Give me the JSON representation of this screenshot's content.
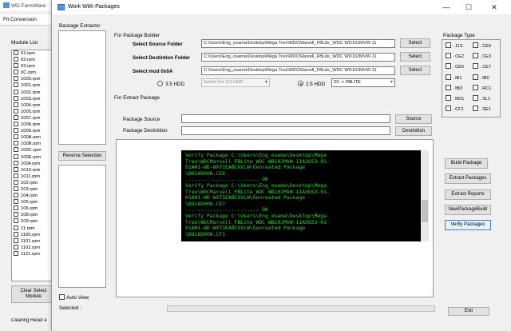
{
  "background_window": {
    "title": "WD FarmWare",
    "tab": "Fit Conversion",
    "module_list_label": "Module List",
    "modules": [
      "01.rpm",
      "02.rpm",
      "03.rpm",
      "0C.rpm",
      "1000.rpm",
      "1001.rpm",
      "1002.rpm",
      "1003.rpm",
      "1004.rpm",
      "1005.rpm",
      "1007.rpm",
      "1008.rpm",
      "1009.rpm",
      "100A.rpm",
      "100B.rpm",
      "100C.rpm",
      "100E.rpm",
      "100F.rpm",
      "1010.rpm",
      "1011.rpm",
      "102.rpm",
      "103.rpm",
      "104.rpm",
      "105.rpm",
      "106.rpm",
      "108.rpm",
      "109.rpm",
      "11.rpm",
      "1100.rpm",
      "1101.rpm",
      "1102.rpm",
      "1121.rpm"
    ],
    "clear_button": "Clear Select Module",
    "status": "Clearing Reset e"
  },
  "window": {
    "title": "Work With Packages",
    "controls": {
      "minimize": "—",
      "maximize": "☐",
      "close": "✕"
    }
  },
  "extractor": {
    "label": "Backage Extractor",
    "reverse_button": "Reverse Selection",
    "auto_view_label": "Auto View",
    "selected_label": "Selected :"
  },
  "builder": {
    "group_label": "For Package Builder",
    "source_label": "Select Source Folder",
    "source_path": "C:\\Users\\Eng_osama\\Desktop\\Mega Trex\\WDCMarvell_FBLite_WDC WD10JMVW-11",
    "dest_label": "Select Destintion Folder",
    "dest_path": "C:\\Users\\Eng_osama\\Desktop\\Mega Trex\\WDCMarvell_FBLite_WDC WD10JMVW-11",
    "mod_label": "Select mod 0x0A",
    "mod_path": "C:\\Users\\Eng_osama\\Desktop\\Mega Trex\\WDCMarvell_FBLite_WDC WD10JMVW-11",
    "select_button": "Select",
    "hdd35_label": "3.5 HDD",
    "hdd35_combo": "Select For 3.5 HDD",
    "hdd25_label": "2.5 HDD",
    "hdd25_combo": "23 -> FBLITE"
  },
  "extract": {
    "group_label": "For Extract Package",
    "source_label": "Package Source",
    "dest_label": "Package Destinition",
    "source_button": "Source",
    "dest_button": "Destinition"
  },
  "console": {
    "text": "Verify Package C:\\Users\\Eng_osama\\Desktop\\Mega\nTrex\\WDCMarvell_FBLite_WDC WD10JMVW-11A3GS3-01-\n01A01-WD-WXT1EA8CXVLW\\Genreated Package\n\\DO16D00N.CE6\n........................ OK\nVerify Package C:\\Users\\Eng_osama\\Desktop\\Mega\nTrex\\WDCMarvell_FBLite_WDC WD10JMVW-11A3GS3-01-\n01A01-WD-WXT1EA8CXVLW\\Genreated Package\n\\DO16D00N.CE7\n........................ OK\nVerify Package C:\\Users\\Eng_osama\\Desktop\\Mega\nTrex\\WDCMarvell_FBLite_WDC WD10JMVW-11A3GS3-01-\n01A01-WD-WXT1EA8CXVLW\\Genreated Package\n\\DO16D00N.CF1"
  },
  "package_type": {
    "label": "Package Type",
    "items": [
      "11S",
      "CE0",
      "CE2",
      "CE3",
      "CE6",
      "CE7",
      "IB1",
      "IBC",
      "IBD",
      "RC1",
      "RD1",
      "SL1",
      "CF1",
      "SE1"
    ]
  },
  "actions": {
    "build": "Build Package",
    "extract": "Extract  Packages",
    "reports": "Extract Reports",
    "new_build": "NewPackageBuild",
    "verify": "Verfiy Packages",
    "exit": "Exit"
  }
}
